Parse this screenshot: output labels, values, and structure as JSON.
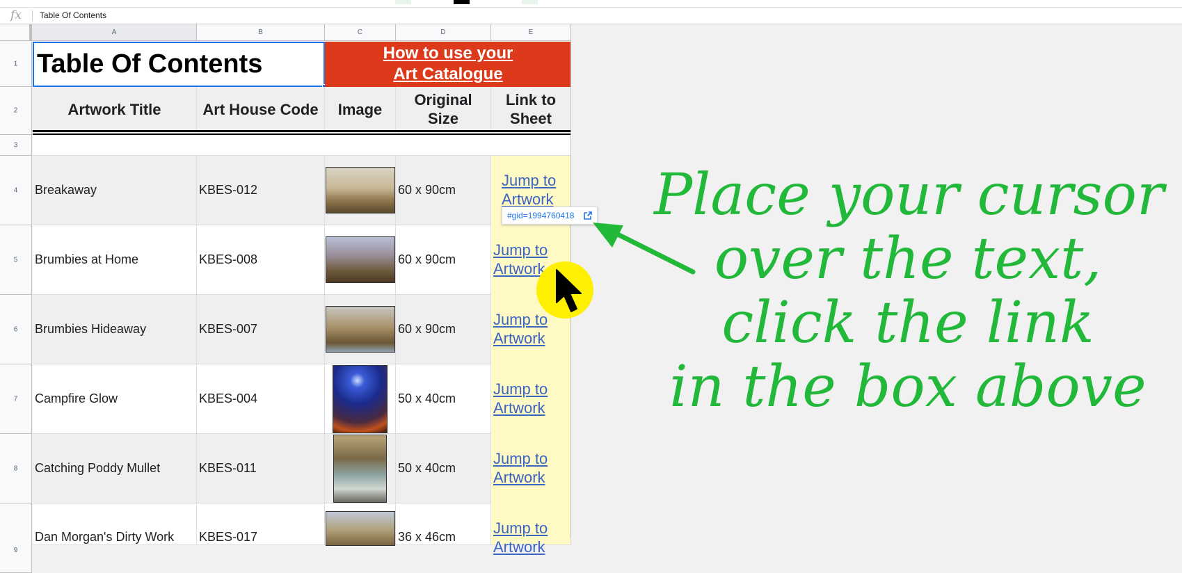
{
  "formula_bar": {
    "fx_label": "fx",
    "value": "Table Of Contents"
  },
  "columns": [
    "A",
    "B",
    "C",
    "D",
    "E"
  ],
  "rows": [
    "1",
    "2",
    "3",
    "4",
    "5",
    "6",
    "7",
    "8",
    "9"
  ],
  "title": "Table Of Contents",
  "how_to": {
    "line1": "How to use your",
    "line2": "Art Catalogue"
  },
  "headers": {
    "title": "Artwork Title",
    "code": "Art House Code",
    "image": "Image",
    "size_l1": "Original",
    "size_l2": "Size",
    "link_l1": "Link to",
    "link_l2": "Sheet"
  },
  "artworks": [
    {
      "title": "Breakaway",
      "code": "KBES-012",
      "size": "60 x 90cm",
      "link_l1": "Jump to",
      "link_l2": "Artwork"
    },
    {
      "title": "Brumbies at Home",
      "code": "KBES-008",
      "size": "60 x 90cm",
      "link_l1": "Jump to",
      "link_l2": "Artwork"
    },
    {
      "title": "Brumbies Hideaway",
      "code": "KBES-007",
      "size": "60 x 90cm",
      "link_l1": "Jump to",
      "link_l2": "Artwork"
    },
    {
      "title": "Campfire Glow",
      "code": "KBES-004",
      "size": "50 x 40cm",
      "link_l1": "Jump to",
      "link_l2": "Artwork"
    },
    {
      "title": "Catching Poddy Mullet",
      "code": "KBES-011",
      "size": "50 x 40cm",
      "link_l1": "Jump to",
      "link_l2": "Artwork"
    },
    {
      "title": "Dan Morgan's Dirty Work",
      "code": "KBES-017",
      "size": "36 x 46cm",
      "link_l1": "Jump to",
      "link_l2": "Artwork"
    }
  ],
  "tooltip": {
    "text": "#gid=1994760418",
    "icon": "external-link-icon"
  },
  "annotation": {
    "line1": "Place your cursor",
    "line2": "over the text,",
    "line3": "click the link",
    "line4": "in the box above"
  },
  "colors": {
    "howto_bg": "#dc3a1a",
    "link": "#3c64c4",
    "link_col_bg": "#fff9c4",
    "annotation": "#22b83a",
    "cursor_glow": "#ffef00",
    "selection": "#1a73e8"
  }
}
